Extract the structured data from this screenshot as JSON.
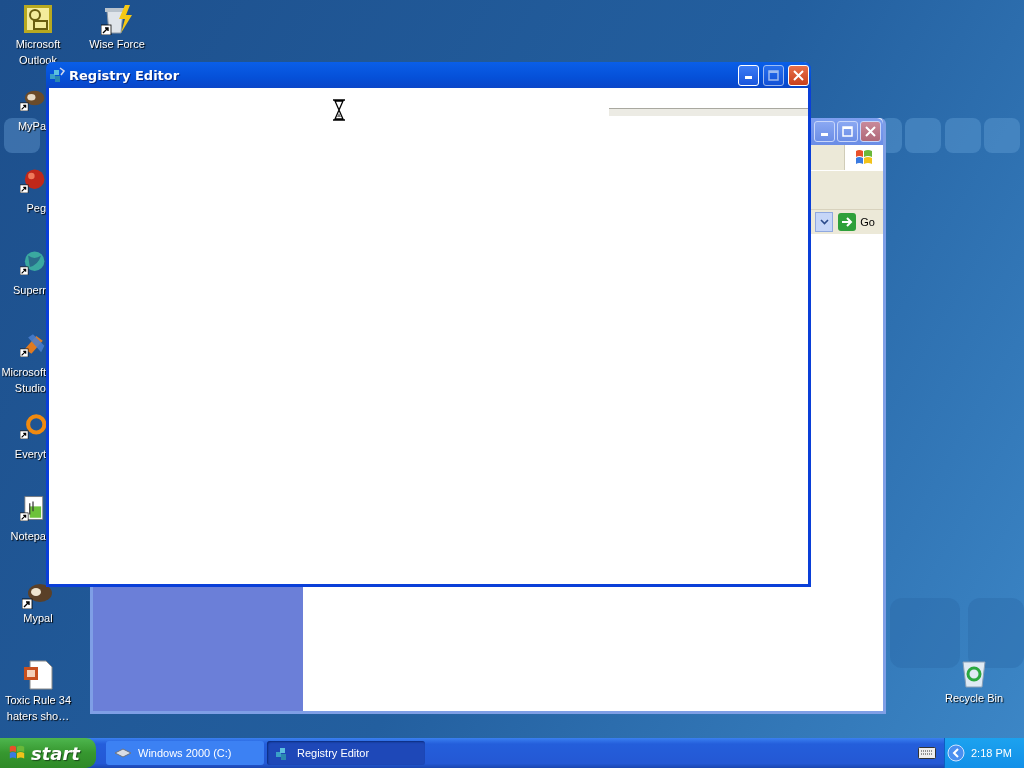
{
  "desktop_icons": [
    {
      "lines": [
        "Microsoft",
        "Outlook"
      ]
    },
    {
      "lines": [
        "MyPa"
      ]
    },
    {
      "lines": [
        "Peg"
      ]
    },
    {
      "lines": [
        "Superr"
      ]
    },
    {
      "lines": [
        "Microsoft",
        "Studio"
      ]
    },
    {
      "lines": [
        "Everyt"
      ]
    },
    {
      "lines": [
        "Notepa"
      ]
    },
    {
      "lines": [
        "Mypal"
      ]
    },
    {
      "lines": [
        "Toxic Rule 34",
        "haters sho…"
      ]
    }
  ],
  "extra_icons": [
    {
      "lines": [
        "Wise Force"
      ]
    },
    {
      "lines": [
        "Recycle Bin"
      ]
    }
  ],
  "back_window": {
    "go_button": "Go"
  },
  "front_window": {
    "title": "Registry Editor"
  },
  "taskbar": {
    "start": "start",
    "tasks": [
      {
        "label": "Windows 2000 (C:)",
        "selected": false
      },
      {
        "label": "Registry Editor",
        "selected": true
      }
    ],
    "clock": "2:18 PM"
  }
}
